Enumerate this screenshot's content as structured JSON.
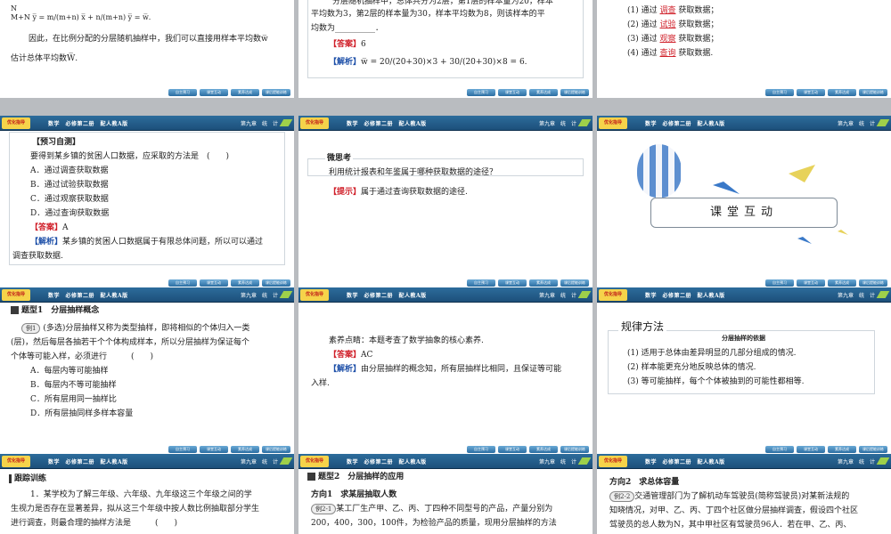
{
  "header": {
    "logo": "优化指导",
    "book": "数学　必修第二册　配人教A版",
    "chapter": "第九章　统　计"
  },
  "footer": [
    "自主预习",
    "课堂互动",
    "素养达成",
    "课后提能训练"
  ],
  "s1": {
    "frac_n_line": "N",
    "formula": "M+N y̅ = m/(m+n) x̅ + n/(m+n) y̅ = w̅.",
    "line1": "因此，在比例分配的分层随机抽样中，我们可以直接用样本平均数w̅",
    "line2": "估计总体平均数W̅."
  },
  "s2": {
    "line0": "分层随机抽样中，总体共分为2层，第1层的样本量为20，样本",
    "line1": "平均数为3，第2层的样本量为30，样本平均数为8，则该样本的平",
    "line2": "均数为__________．",
    "ans_label": "【答案】",
    "ans": "6",
    "jx_label": "【解析】",
    "jx": "w̅ = 20/(20+30)×3 + 30/(20+30)×8 = 6."
  },
  "s3": {
    "items": [
      {
        "pre": "(1) 通过",
        "fill": "调查",
        "post": "获取数据；"
      },
      {
        "pre": "(2) 通过",
        "fill": "试验",
        "post": "获取数据；"
      },
      {
        "pre": "(3) 通过",
        "fill": "观察",
        "post": "获取数据；"
      },
      {
        "pre": "(4) 通过",
        "fill": "查询",
        "post": "获取数据."
      }
    ]
  },
  "s4": {
    "title": "【预习自测】",
    "q": "要得到某乡镇的贫困人口数据，应采取的方法是　(　　)",
    "opts": [
      "A．通过调查获取数据",
      "B．通过试验获取数据",
      "C．通过观察获取数据",
      "D．通过查询获取数据"
    ],
    "ans_label": "【答案】",
    "ans": "A",
    "jx_label": "【解析】",
    "jx1": "某乡镇的贫困人口数据属于有限总体问题，所以可以通过",
    "jx2": "调查获取数据."
  },
  "s5": {
    "title": "微思考",
    "q": "利用统计报表和年鉴属于哪种获取数据的途径？",
    "tip_label": "【提示】",
    "tip": "属于通过查询获取数据的途径."
  },
  "s6": {
    "banner": "课堂互动"
  },
  "s7": {
    "title": "题型1　分层抽样概念",
    "ex": "例1",
    "q1": "(多选)分层抽样又称为类型抽样，即将相似的个体归入一类",
    "q2": "(层)，然后每层各抽若干个个体构成样本，所以分层抽样为保证每个",
    "q3": "个体等可能入样，必须进行　　　(　　)",
    "opts": [
      "A．每层内等可能抽样",
      "B．每层内不等可能抽样",
      "C．所有层用同一抽样比",
      "D．所有层抽同样多样本容量"
    ]
  },
  "s8": {
    "line": "素养点睛：本题考查了数学抽象的核心素养.",
    "ans_label": "【答案】",
    "ans": "AC",
    "jx_label": "【解析】",
    "jx1": "由分层抽样的概念知，所有层抽样比相同，且保证等可能",
    "jx2": "入样."
  },
  "s9": {
    "title": "规律方法",
    "sub": "分层抽样的依据",
    "items": [
      "(1) 适用于总体由差异明显的几部分组成的情况.",
      "(2) 样本能更充分地反映总体的情况.",
      "(3) 等可能抽样，每个个体被抽到的可能性都相等."
    ]
  },
  "s10": {
    "title": "跟踪训练",
    "q1": "1．某学校为了解三年级、六年级、九年级这三个年级之间的学",
    "q2": "生视力是否存在显著差异，拟从这三个年级中按人数比例抽取部分学生",
    "q3": "进行调查，则最合理的抽样方法是　　　(　　)"
  },
  "s11": {
    "title": "题型2　分层抽样的应用",
    "dir": "方向1　求某层抽取人数",
    "ex": "例2-1",
    "q1": "某工厂生产甲、乙、丙、丁四种不同型号的产品，产量分别为",
    "q2": "200，400，300，100件，为检验产品的质量，现用分层抽样的方法"
  },
  "s12": {
    "dir": "方向2　求总体容量",
    "ex": "例2-2",
    "q1": "交通管理部门为了解机动车驾驶员(简称驾驶员)对某新法规的",
    "q2": "知晓情况，对甲、乙、丙、丁四个社区做分层抽样调查，假设四个社区",
    "q3": "驾驶员的总人数为N，其中甲社区有驾驶员96人．若在甲、乙、丙、"
  }
}
